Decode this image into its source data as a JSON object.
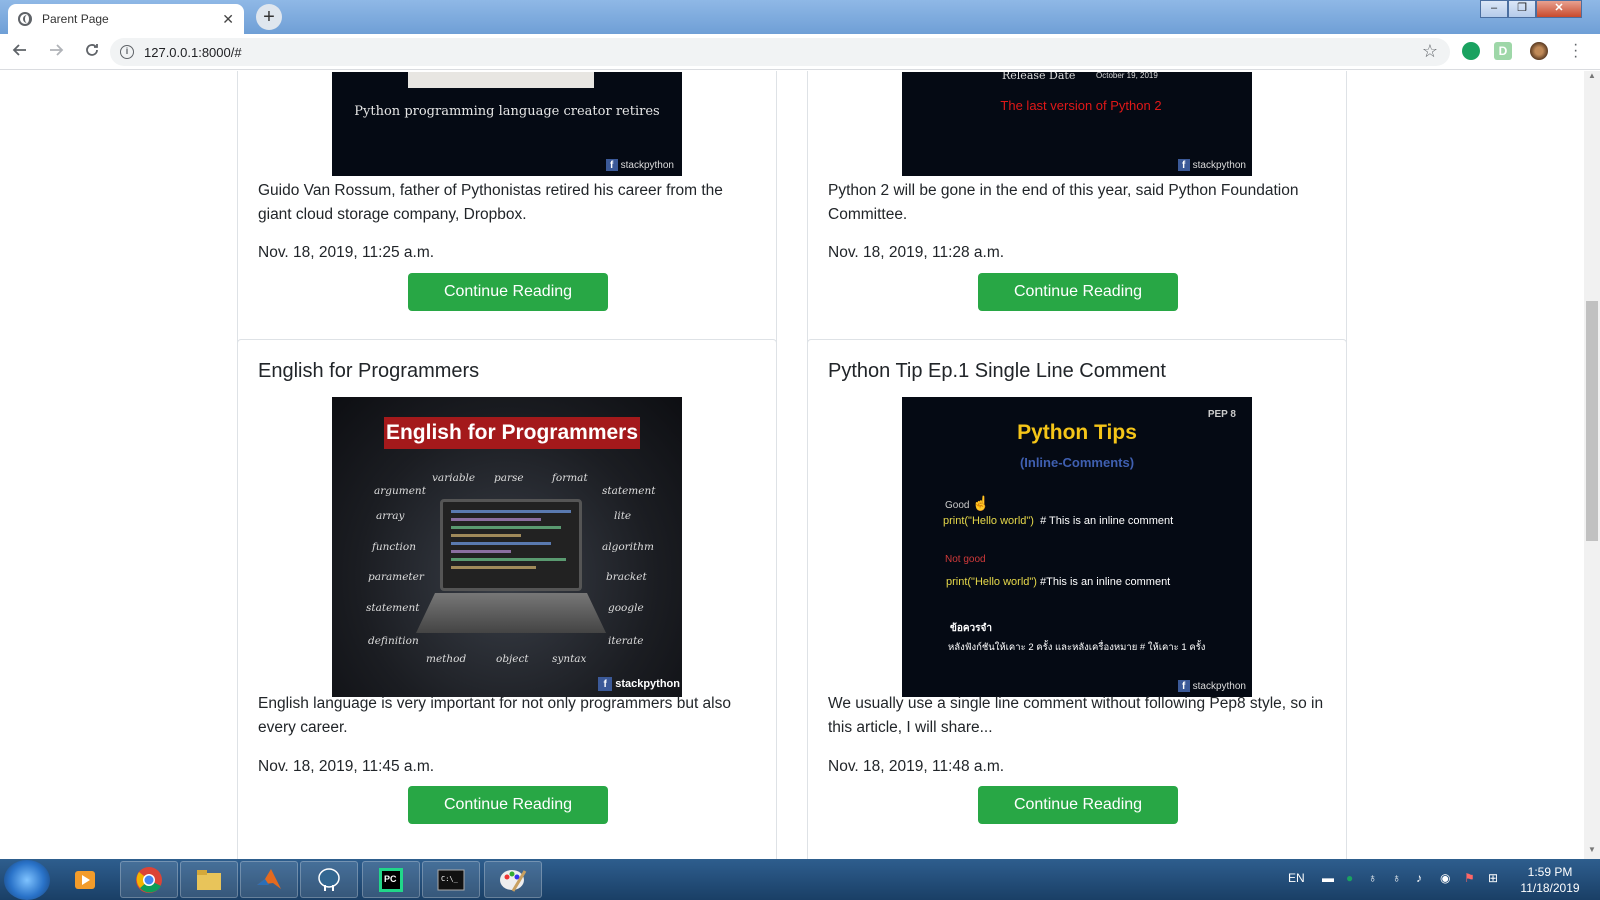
{
  "browser": {
    "tab_title": "Parent Page",
    "tab_close": "✕",
    "new_tab": "+",
    "url": "127.0.0.1:8000/#",
    "win_min": "–",
    "win_max": "❐",
    "win_close": "✕"
  },
  "cards": [
    {
      "image": {
        "caption": "Python programming language creator retires",
        "brand": "stackpython"
      },
      "description": "Guido Van Rossum, father of Pythonistas retired his career from the giant cloud storage company, Dropbox.",
      "date": "Nov. 18, 2019, 11:25 a.m.",
      "button": "Continue Reading"
    },
    {
      "image": {
        "release_label": "Release Date",
        "release_date": "October 19, 2019",
        "caption": "The last version of Python 2",
        "brand": "stackpython"
      },
      "description": "Python 2 will be gone in the end of this year, said Python Foundation Committee.",
      "date": "Nov. 18, 2019, 11:28 a.m.",
      "button": "Continue Reading"
    },
    {
      "title": "English for Programmers",
      "image": {
        "banner": "English for Programmers",
        "words": [
          "variable",
          "parse",
          "format",
          "argument",
          "statement",
          "array",
          "lite",
          "function",
          "algorithm",
          "parameter",
          "bracket",
          "statement",
          "google",
          "definition",
          "iterate",
          "method",
          "object",
          "syntax"
        ],
        "brand": "stackpython"
      },
      "description": "English language is very important for not only programmers but also every career.",
      "date": "Nov. 18, 2019, 11:45 a.m.",
      "button": "Continue Reading"
    },
    {
      "title": "Python Tip Ep.1 Single Line Comment",
      "image": {
        "tag": "PEP 8",
        "heading": "Python Tips",
        "sub": "(Inline-Comments)",
        "good_label": "Good",
        "good_code": "print(\"Hello world\")",
        "good_comment": "# This is an inline comment",
        "bad_label": "Not good",
        "bad_code": "print(\"Hello world\")",
        "bad_comment": "#This is an inline comment",
        "note_title": "ข้อควรจำ",
        "note_text": "หลังฟังก์ชันให้เคาะ 2 ครั้ง และหลังเครื่องหมาย # ให้เคาะ 1 ครั้ง",
        "brand": "stackpython"
      },
      "description": "We usually use a single line comment without following Pep8 style, so in this article, I will share...",
      "date": "Nov. 18, 2019, 11:48 a.m.",
      "button": "Continue Reading"
    }
  ],
  "taskbar": {
    "lang": "EN",
    "time": "1:59 PM",
    "date": "11/18/2019",
    "apps": [
      "media-player-icon",
      "chrome-icon",
      "file-explorer-icon",
      "matlab-icon",
      "postgres-icon",
      "pycharm-icon",
      "cmd-icon",
      "paint-icon"
    ]
  }
}
